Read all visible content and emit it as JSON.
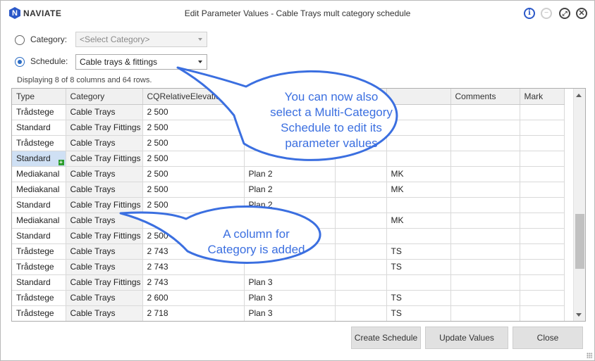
{
  "app": {
    "logo_letter": "N",
    "logo_text": "NAVIATE",
    "title": "Edit Parameter Values - Cable Trays mult category schedule"
  },
  "titlebar": {
    "info_glyph": "i",
    "minimize_glyph": "−",
    "maximize_glyph": "⤢",
    "close_glyph": "✕"
  },
  "form": {
    "category_label": "Category:",
    "category_placeholder": "<Select Category>",
    "schedule_label": "Schedule:",
    "schedule_value": "Cable trays & fittings",
    "category_selected": false,
    "schedule_selected": true
  },
  "status": "Displaying 8 of 8 columns and 64 rows.",
  "table": {
    "columns": [
      "Type",
      "Category",
      "CQRelativeElevation",
      "",
      "",
      "",
      "Comments",
      "Mark"
    ],
    "rows": [
      [
        "Trådstege",
        "Cable Trays",
        "2 500",
        "",
        "",
        "",
        "",
        ""
      ],
      [
        "Standard",
        "Cable Tray Fittings",
        "2 500",
        "",
        "",
        "",
        "",
        ""
      ],
      [
        "Trådstege",
        "Cable Trays",
        "2 500",
        "",
        "",
        "",
        "",
        ""
      ],
      [
        "Standard",
        "Cable Tray Fittings",
        "2 500",
        "",
        "",
        "",
        "",
        ""
      ],
      [
        "Mediakanal",
        "Cable Trays",
        "2 500",
        "Plan 2",
        "",
        "MK",
        "",
        ""
      ],
      [
        "Mediakanal",
        "Cable Trays",
        "2 500",
        "Plan 2",
        "",
        "MK",
        "",
        ""
      ],
      [
        "Standard",
        "Cable Tray Fittings",
        "2 500",
        "Plan 2",
        "",
        "",
        "",
        ""
      ],
      [
        "Mediakanal",
        "Cable Trays",
        "",
        "",
        "",
        "MK",
        "",
        ""
      ],
      [
        "Standard",
        "Cable Tray Fittings",
        "2 500",
        "",
        "",
        "",
        "",
        ""
      ],
      [
        "Trådstege",
        "Cable Trays",
        "2 743",
        "",
        "",
        "TS",
        "",
        ""
      ],
      [
        "Trådstege",
        "Cable Trays",
        "2 743",
        "",
        "",
        "TS",
        "",
        ""
      ],
      [
        "Standard",
        "Cable Tray Fittings",
        "2 743",
        "Plan 3",
        "",
        "",
        "",
        ""
      ],
      [
        "Trådstege",
        "Cable Trays",
        "2 600",
        "Plan 3",
        "",
        "TS",
        "",
        ""
      ],
      [
        "Trådstege",
        "Cable Trays",
        "2 718",
        "Plan 3",
        "",
        "TS",
        "",
        ""
      ]
    ],
    "selected_cell": {
      "row": 3,
      "col": 0
    }
  },
  "buttons": {
    "create_schedule": "Create Schedule",
    "update_values": "Update Values",
    "close": "Close"
  },
  "callouts": {
    "top_lines": [
      "You can now also",
      "select a Multi-Category",
      "Schedule to edit its",
      "parameter values"
    ],
    "bottom_lines": [
      "A column for",
      "Category is added"
    ]
  },
  "colors": {
    "accent": "#2b58c8",
    "callout_stroke": "#3b6fe0",
    "selection": "#cfe0f4"
  }
}
